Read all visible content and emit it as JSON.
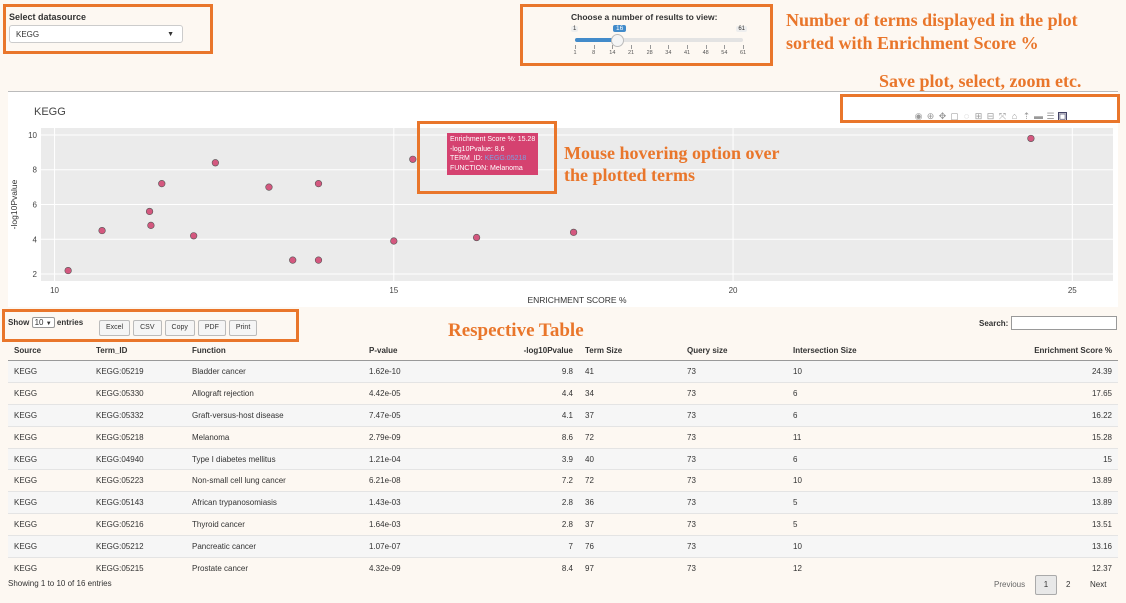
{
  "datasource": {
    "label": "Select datasource",
    "selected": "KEGG"
  },
  "slider": {
    "label": "Choose a number of results to view:",
    "min": "1",
    "max": "61",
    "value": "16",
    "value_fraction": 0.25,
    "ticks": [
      "1",
      "8",
      "14",
      "21",
      "28",
      "34",
      "41",
      "48",
      "54",
      "61"
    ]
  },
  "annotations": {
    "terms_line1": "Number of terms displayed in the plot",
    "terms_line2": "sorted with Enrichment Score %",
    "toolbar": "Save plot, select, zoom etc.",
    "hover_line1": "Mouse hovering option over",
    "hover_line2": "the plotted terms",
    "table": "Respective Table"
  },
  "plot": {
    "title": "KEGG",
    "xlabel": "ENRICHMENT SCORE %",
    "ylabel": "-log10Pvalue",
    "toolbar_icons": [
      "camera-icon",
      "zoom-icon",
      "pan-icon",
      "box-select-icon",
      "lasso-icon",
      "zoom-in-icon",
      "zoom-out-icon",
      "autoscale-icon",
      "reset-axes-icon",
      "spike-lines-icon",
      "compare-hover-icon",
      "closest-hover-icon",
      "plotly-logo-icon"
    ],
    "tooltip": {
      "line1": "Enrichment Score %: 15.28",
      "line2": "-log10Pvalue: 8.6",
      "line3_label": "TERM_ID:",
      "line3_value": "KEGG:05218",
      "line4": "FUNCTION: Melanoma"
    }
  },
  "chart_data": {
    "type": "scatter",
    "title": "KEGG",
    "xlabel": "ENRICHMENT SCORE %",
    "ylabel": "-log10Pvalue",
    "xlim": [
      9.8,
      25.6
    ],
    "ylim": [
      1.6,
      10.4
    ],
    "xticks": [
      "10",
      "15",
      "20",
      "25"
    ],
    "yticks": [
      "2",
      "4",
      "6",
      "8",
      "10"
    ],
    "marker_color": "#d4587f",
    "points": [
      {
        "x": 24.39,
        "y": 9.8
      },
      {
        "x": 17.65,
        "y": 4.4
      },
      {
        "x": 16.22,
        "y": 4.1
      },
      {
        "x": 15.28,
        "y": 8.6
      },
      {
        "x": 15.0,
        "y": 3.9
      },
      {
        "x": 13.89,
        "y": 7.2
      },
      {
        "x": 13.89,
        "y": 2.8
      },
      {
        "x": 13.51,
        "y": 2.8
      },
      {
        "x": 13.16,
        "y": 7.0
      },
      {
        "x": 12.37,
        "y": 8.4
      },
      {
        "x": 12.05,
        "y": 4.2
      },
      {
        "x": 11.58,
        "y": 7.2
      },
      {
        "x": 11.42,
        "y": 4.8
      },
      {
        "x": 11.4,
        "y": 5.6
      },
      {
        "x": 10.7,
        "y": 4.5
      },
      {
        "x": 10.2,
        "y": 2.2
      }
    ]
  },
  "table_controls": {
    "show": "Show",
    "entries_value": "10",
    "entries": "entries",
    "buttons": [
      "Excel",
      "CSV",
      "Copy",
      "PDF",
      "Print"
    ],
    "search": "Search:"
  },
  "table": {
    "headers": [
      "Source",
      "Term_ID",
      "Function",
      "P-value",
      "-log10Pvalue",
      "Term Size",
      "Query size",
      "Intersection Size",
      "Enrichment Score %"
    ],
    "rows": [
      [
        "KEGG",
        "KEGG:05219",
        "Bladder cancer",
        "1.62e-10",
        "9.8",
        "41",
        "73",
        "10",
        "24.39"
      ],
      [
        "KEGG",
        "KEGG:05330",
        "Allograft rejection",
        "4.42e-05",
        "4.4",
        "34",
        "73",
        "6",
        "17.65"
      ],
      [
        "KEGG",
        "KEGG:05332",
        "Graft-versus-host disease",
        "7.47e-05",
        "4.1",
        "37",
        "73",
        "6",
        "16.22"
      ],
      [
        "KEGG",
        "KEGG:05218",
        "Melanoma",
        "2.79e-09",
        "8.6",
        "72",
        "73",
        "11",
        "15.28"
      ],
      [
        "KEGG",
        "KEGG:04940",
        "Type I diabetes mellitus",
        "1.21e-04",
        "3.9",
        "40",
        "73",
        "6",
        "15"
      ],
      [
        "KEGG",
        "KEGG:05223",
        "Non-small cell lung cancer",
        "6.21e-08",
        "7.2",
        "72",
        "73",
        "10",
        "13.89"
      ],
      [
        "KEGG",
        "KEGG:05143",
        "African trypanosomiasis",
        "1.43e-03",
        "2.8",
        "36",
        "73",
        "5",
        "13.89"
      ],
      [
        "KEGG",
        "KEGG:05216",
        "Thyroid cancer",
        "1.64e-03",
        "2.8",
        "37",
        "73",
        "5",
        "13.51"
      ],
      [
        "KEGG",
        "KEGG:05212",
        "Pancreatic cancer",
        "1.07e-07",
        "7",
        "76",
        "73",
        "10",
        "13.16"
      ],
      [
        "KEGG",
        "KEGG:05215",
        "Prostate cancer",
        "4.32e-09",
        "8.4",
        "97",
        "73",
        "12",
        "12.37"
      ]
    ],
    "info": "Showing 1 to 10 of 16 entries",
    "pager": {
      "previous": "Previous",
      "page1": "1",
      "page2": "2",
      "next": "Next"
    }
  },
  "colors": {
    "annotation": "#e9762b",
    "marker": "#d4587f",
    "tooltip": "#d54270",
    "link": "#337ab7"
  }
}
